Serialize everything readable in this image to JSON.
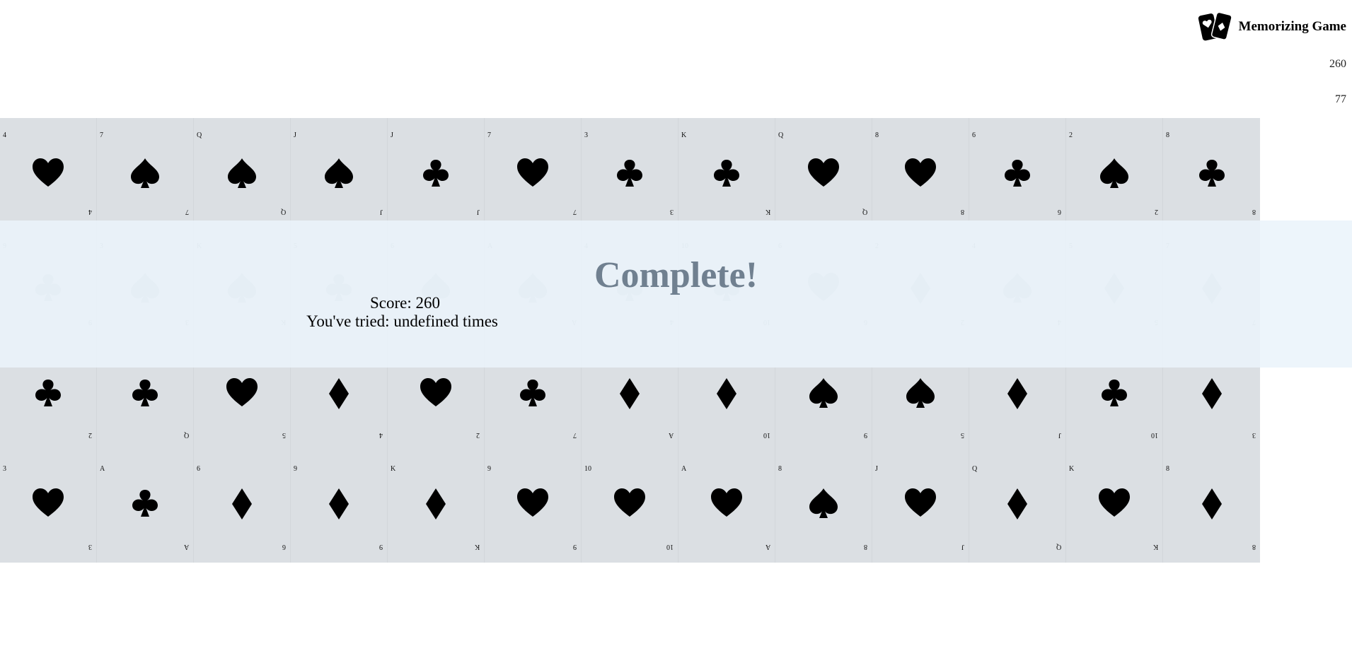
{
  "app": {
    "title": "Memorizing Game",
    "logo_icon": "playing-cards-icon"
  },
  "stats": {
    "score": "260",
    "tries": "77"
  },
  "overlay": {
    "title": "Complete!",
    "score_text": "Score: 260",
    "tries_text": "You've tried: undefined times"
  },
  "colors": {
    "card_bg": "#dbdfe3",
    "overlay_bg": "#ebf4fa",
    "overlay_title": "#708090",
    "suit": "#000000",
    "suit_faded": "#b8c1c8"
  },
  "rows": [
    {
      "cards": [
        {
          "rank": "4",
          "suit": "heart"
        },
        {
          "rank": "7",
          "suit": "spade"
        },
        {
          "rank": "Q",
          "suit": "spade"
        },
        {
          "rank": "J",
          "suit": "spade"
        },
        {
          "rank": "J",
          "suit": "club"
        },
        {
          "rank": "7",
          "suit": "heart"
        },
        {
          "rank": "3",
          "suit": "club"
        },
        {
          "rank": "K",
          "suit": "club"
        },
        {
          "rank": "Q",
          "suit": "heart"
        },
        {
          "rank": "8",
          "suit": "heart"
        },
        {
          "rank": "6",
          "suit": "club"
        },
        {
          "rank": "2",
          "suit": "spade"
        },
        {
          "rank": "8",
          "suit": "club"
        }
      ]
    },
    {
      "faded": true,
      "cards": [
        {
          "rank": "9",
          "suit": "club"
        },
        {
          "rank": "3",
          "suit": "spade"
        },
        {
          "rank": "K",
          "suit": "spade"
        },
        {
          "rank": "5",
          "suit": "club"
        },
        {
          "rank": "6",
          "suit": "spade"
        },
        {
          "rank": "A",
          "suit": "spade"
        },
        {
          "rank": "4",
          "suit": "club"
        },
        {
          "rank": "10",
          "suit": "club"
        },
        {
          "rank": "6",
          "suit": "heart"
        },
        {
          "rank": "2",
          "suit": "diamond"
        },
        {
          "rank": "4",
          "suit": "spade"
        },
        {
          "rank": "5",
          "suit": "diamond"
        },
        {
          "rank": "7",
          "suit": "diamond"
        }
      ]
    },
    {
      "cards": [
        {
          "rank": "2",
          "suit": "club"
        },
        {
          "rank": "Q",
          "suit": "club"
        },
        {
          "rank": "5",
          "suit": "heart"
        },
        {
          "rank": "4",
          "suit": "diamond"
        },
        {
          "rank": "2",
          "suit": "heart"
        },
        {
          "rank": "7",
          "suit": "club"
        },
        {
          "rank": "A",
          "suit": "diamond"
        },
        {
          "rank": "10",
          "suit": "diamond"
        },
        {
          "rank": "9",
          "suit": "spade"
        },
        {
          "rank": "5",
          "suit": "spade"
        },
        {
          "rank": "J",
          "suit": "diamond"
        },
        {
          "rank": "10",
          "suit": "club"
        },
        {
          "rank": "3",
          "suit": "diamond"
        }
      ]
    },
    {
      "cards": [
        {
          "rank": "3",
          "suit": "heart"
        },
        {
          "rank": "A",
          "suit": "club"
        },
        {
          "rank": "6",
          "suit": "diamond"
        },
        {
          "rank": "9",
          "suit": "diamond"
        },
        {
          "rank": "K",
          "suit": "diamond"
        },
        {
          "rank": "9",
          "suit": "heart"
        },
        {
          "rank": "10",
          "suit": "heart"
        },
        {
          "rank": "A",
          "suit": "heart"
        },
        {
          "rank": "8",
          "suit": "spade"
        },
        {
          "rank": "J",
          "suit": "heart"
        },
        {
          "rank": "Q",
          "suit": "diamond"
        },
        {
          "rank": "K",
          "suit": "heart"
        },
        {
          "rank": "8",
          "suit": "diamond"
        }
      ]
    }
  ]
}
